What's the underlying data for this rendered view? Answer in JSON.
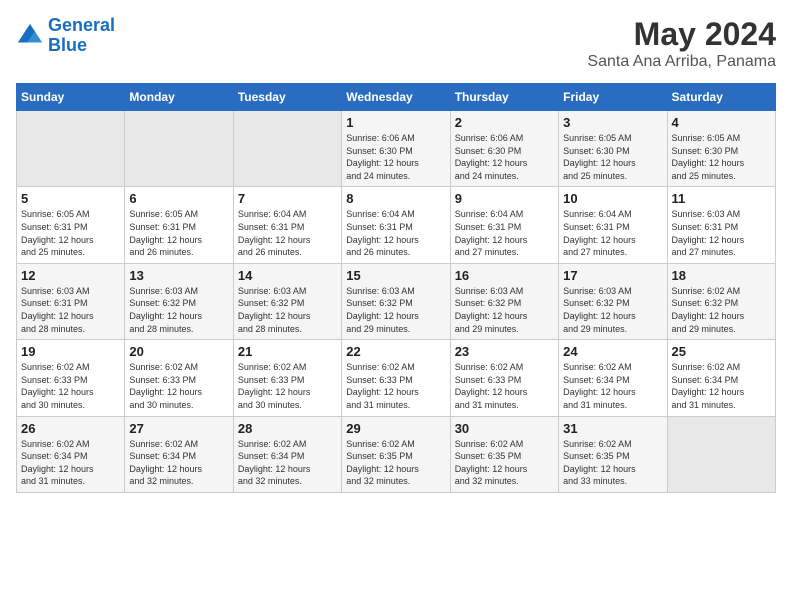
{
  "logo": {
    "line1": "General",
    "line2": "Blue"
  },
  "title": "May 2024",
  "subtitle": "Santa Ana Arriba, Panama",
  "days_header": [
    "Sunday",
    "Monday",
    "Tuesday",
    "Wednesday",
    "Thursday",
    "Friday",
    "Saturday"
  ],
  "weeks": [
    {
      "days": [
        {
          "num": "",
          "info": "",
          "empty": true
        },
        {
          "num": "",
          "info": "",
          "empty": true
        },
        {
          "num": "",
          "info": "",
          "empty": true
        },
        {
          "num": "1",
          "info": "Sunrise: 6:06 AM\nSunset: 6:30 PM\nDaylight: 12 hours\nand 24 minutes."
        },
        {
          "num": "2",
          "info": "Sunrise: 6:06 AM\nSunset: 6:30 PM\nDaylight: 12 hours\nand 24 minutes."
        },
        {
          "num": "3",
          "info": "Sunrise: 6:05 AM\nSunset: 6:30 PM\nDaylight: 12 hours\nand 25 minutes."
        },
        {
          "num": "4",
          "info": "Sunrise: 6:05 AM\nSunset: 6:30 PM\nDaylight: 12 hours\nand 25 minutes."
        }
      ]
    },
    {
      "days": [
        {
          "num": "5",
          "info": "Sunrise: 6:05 AM\nSunset: 6:31 PM\nDaylight: 12 hours\nand 25 minutes."
        },
        {
          "num": "6",
          "info": "Sunrise: 6:05 AM\nSunset: 6:31 PM\nDaylight: 12 hours\nand 26 minutes."
        },
        {
          "num": "7",
          "info": "Sunrise: 6:04 AM\nSunset: 6:31 PM\nDaylight: 12 hours\nand 26 minutes."
        },
        {
          "num": "8",
          "info": "Sunrise: 6:04 AM\nSunset: 6:31 PM\nDaylight: 12 hours\nand 26 minutes."
        },
        {
          "num": "9",
          "info": "Sunrise: 6:04 AM\nSunset: 6:31 PM\nDaylight: 12 hours\nand 27 minutes."
        },
        {
          "num": "10",
          "info": "Sunrise: 6:04 AM\nSunset: 6:31 PM\nDaylight: 12 hours\nand 27 minutes."
        },
        {
          "num": "11",
          "info": "Sunrise: 6:03 AM\nSunset: 6:31 PM\nDaylight: 12 hours\nand 27 minutes."
        }
      ]
    },
    {
      "days": [
        {
          "num": "12",
          "info": "Sunrise: 6:03 AM\nSunset: 6:31 PM\nDaylight: 12 hours\nand 28 minutes."
        },
        {
          "num": "13",
          "info": "Sunrise: 6:03 AM\nSunset: 6:32 PM\nDaylight: 12 hours\nand 28 minutes."
        },
        {
          "num": "14",
          "info": "Sunrise: 6:03 AM\nSunset: 6:32 PM\nDaylight: 12 hours\nand 28 minutes."
        },
        {
          "num": "15",
          "info": "Sunrise: 6:03 AM\nSunset: 6:32 PM\nDaylight: 12 hours\nand 29 minutes."
        },
        {
          "num": "16",
          "info": "Sunrise: 6:03 AM\nSunset: 6:32 PM\nDaylight: 12 hours\nand 29 minutes."
        },
        {
          "num": "17",
          "info": "Sunrise: 6:03 AM\nSunset: 6:32 PM\nDaylight: 12 hours\nand 29 minutes."
        },
        {
          "num": "18",
          "info": "Sunrise: 6:02 AM\nSunset: 6:32 PM\nDaylight: 12 hours\nand 29 minutes."
        }
      ]
    },
    {
      "days": [
        {
          "num": "19",
          "info": "Sunrise: 6:02 AM\nSunset: 6:33 PM\nDaylight: 12 hours\nand 30 minutes."
        },
        {
          "num": "20",
          "info": "Sunrise: 6:02 AM\nSunset: 6:33 PM\nDaylight: 12 hours\nand 30 minutes."
        },
        {
          "num": "21",
          "info": "Sunrise: 6:02 AM\nSunset: 6:33 PM\nDaylight: 12 hours\nand 30 minutes."
        },
        {
          "num": "22",
          "info": "Sunrise: 6:02 AM\nSunset: 6:33 PM\nDaylight: 12 hours\nand 31 minutes."
        },
        {
          "num": "23",
          "info": "Sunrise: 6:02 AM\nSunset: 6:33 PM\nDaylight: 12 hours\nand 31 minutes."
        },
        {
          "num": "24",
          "info": "Sunrise: 6:02 AM\nSunset: 6:34 PM\nDaylight: 12 hours\nand 31 minutes."
        },
        {
          "num": "25",
          "info": "Sunrise: 6:02 AM\nSunset: 6:34 PM\nDaylight: 12 hours\nand 31 minutes."
        }
      ]
    },
    {
      "days": [
        {
          "num": "26",
          "info": "Sunrise: 6:02 AM\nSunset: 6:34 PM\nDaylight: 12 hours\nand 31 minutes."
        },
        {
          "num": "27",
          "info": "Sunrise: 6:02 AM\nSunset: 6:34 PM\nDaylight: 12 hours\nand 32 minutes."
        },
        {
          "num": "28",
          "info": "Sunrise: 6:02 AM\nSunset: 6:34 PM\nDaylight: 12 hours\nand 32 minutes."
        },
        {
          "num": "29",
          "info": "Sunrise: 6:02 AM\nSunset: 6:35 PM\nDaylight: 12 hours\nand 32 minutes."
        },
        {
          "num": "30",
          "info": "Sunrise: 6:02 AM\nSunset: 6:35 PM\nDaylight: 12 hours\nand 32 minutes."
        },
        {
          "num": "31",
          "info": "Sunrise: 6:02 AM\nSunset: 6:35 PM\nDaylight: 12 hours\nand 33 minutes."
        },
        {
          "num": "",
          "info": "",
          "empty": true
        }
      ]
    }
  ]
}
